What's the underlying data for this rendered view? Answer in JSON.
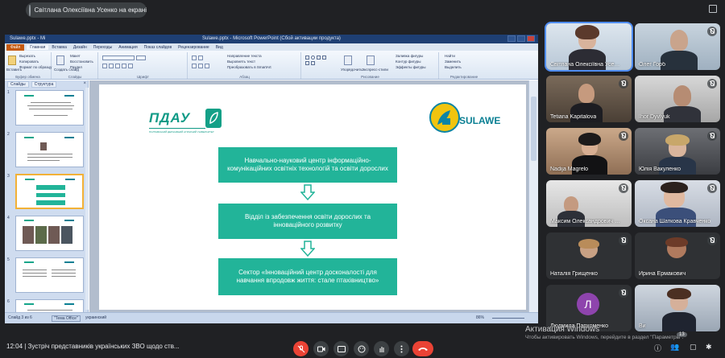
{
  "presenter": {
    "text": "Світлана Олексіївна Усенко на екрані"
  },
  "ppt": {
    "window_title": "Sulawe.pptx - Microsoft PowerPoint (Сбой активации продукта)",
    "qat_text": "Sulawe.pptx - Mi",
    "file_tab": "Файл",
    "tabs": [
      "Главная",
      "Вставка",
      "Дизайн",
      "Переходы",
      "Анимация",
      "Показ слайдов",
      "Рецензирование",
      "Вид"
    ],
    "ribbon": {
      "clipboard_label": "Буфер обмена",
      "slides_label": "Слайды",
      "font_label": "Шрифт",
      "para_label": "Абзац",
      "draw_label": "Рисование",
      "edit_label": "Редактирование",
      "cut": "Вырезать",
      "copy": "Копировать",
      "format_painter": "Формат по образцу",
      "paste": "Вставить",
      "new_slide": "Создать слайд",
      "layout": "Макет",
      "reset": "Восстановить",
      "section": "Раздел",
      "text_dir": "Направление текста",
      "align_text": "Выровнять текст",
      "smartart": "Преобразовать в SmartArt",
      "arrange": "Упорядочить",
      "quick_styles": "Экспресс-стили",
      "shape_fill": "Заливка фигуры",
      "shape_outline": "Контур фигуры",
      "shape_effects": "Эффекты фигуры",
      "find": "Найти",
      "replace": "Заменить",
      "select": "Выделить"
    },
    "left_tabs": [
      "Слайды",
      "Структура"
    ],
    "thumb_numbers": [
      "1",
      "2",
      "3",
      "4",
      "5",
      "6"
    ],
    "slide": {
      "logo_left": "ПДАУ",
      "logo_left_sub": "ПОЛТАВСЬКИЙ ДЕРЖАВНИЙ АГРАРНИЙ УНІВЕРСИТЕТ",
      "logo_right": "SULAWE",
      "box1": "Навчально-науковий центр інформаційно-комунікаційних освітніх технологій та освіти дорослих",
      "box2": "Відділ із забезпечення освіти дорослих та інноваційного розвитку",
      "box3": "Сектор «Інноваційний центр досконалості для навчання впродовж життя: стале птахівництво»"
    },
    "status": {
      "slide_info": "Слайд 3 из 6",
      "theme": "\"Тема Office\"",
      "lang": "украинский",
      "zoom": "86%"
    },
    "accent": "#22b499"
  },
  "participants": [
    {
      "name": "Світлана Олексіївна Усенко",
      "active": true
    },
    {
      "name": "Олег Горб"
    },
    {
      "name": "Tetiana Kapitalova"
    },
    {
      "name": "Ihor Dyvlyuk"
    },
    {
      "name": "Nadija Magrelo"
    },
    {
      "name": "Юлія Вакуленко"
    },
    {
      "name": "Максим Олександрович П..."
    },
    {
      "name": "Оксана Шаткова Кравченко"
    },
    {
      "name": "Наталія Грищенко"
    },
    {
      "name": "Ирина Ермакович"
    },
    {
      "name": "Людмила Пархоменко",
      "initial": "Л"
    },
    {
      "name": "Ви"
    }
  ],
  "watermark": {
    "line1": "Активация Windows",
    "line2": "Чтобы активировать Windows, перейдите в раздел \"Параметры\"."
  },
  "bottom": {
    "meeting": "12:04 | Зустріч представників українських ЗВО щодо ств...",
    "people_count": "13"
  }
}
